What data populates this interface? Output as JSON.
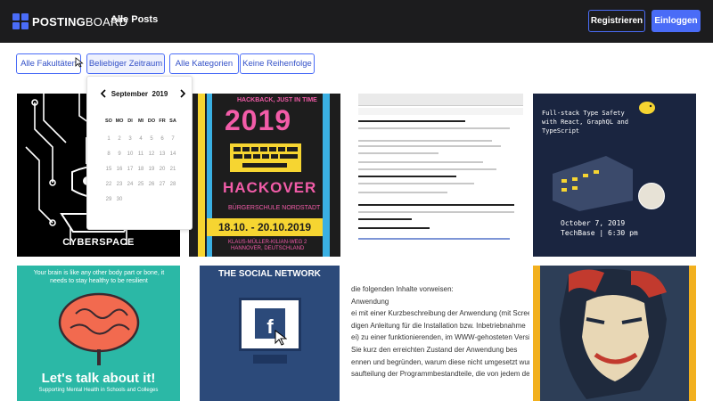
{
  "header": {
    "logo_bold": "POSTING",
    "logo_rest": "BOARD",
    "nav_all_posts": "Alle Posts",
    "register_label": "Registrieren",
    "login_label": "Einloggen",
    "accent_color": "#4a6cf7"
  },
  "filters": {
    "faculties": "Alle Fakultäten",
    "period": "Beliebiger Zeitraum",
    "categories": "Alle Kategorien",
    "order": "Keine Reihenfolge"
  },
  "calendar": {
    "month": "September",
    "year": "2019",
    "weekdays": [
      "SO",
      "MO",
      "DI",
      "MI",
      "DO",
      "FR",
      "SA"
    ],
    "days": [
      "1",
      "2",
      "3",
      "4",
      "5",
      "6",
      "7",
      "8",
      "9",
      "10",
      "11",
      "12",
      "13",
      "14",
      "15",
      "16",
      "17",
      "18",
      "19",
      "20",
      "21",
      "22",
      "23",
      "24",
      "25",
      "26",
      "27",
      "28",
      "29",
      "30"
    ],
    "prev_icon": "chevron-left-icon",
    "next_icon": "chevron-right-icon"
  },
  "posts": {
    "cyberspace": {
      "label": "CYBERSPACE"
    },
    "hackover": {
      "top": "HACKBACK, JUST IN TIME",
      "year": "2019",
      "name": "HACKOVER",
      "school": "BÜRGERSCHULE NORDSTADT",
      "dates": "18.10. - 20.10.2019",
      "address1": "KLAUS-MÜLLER-KILIAN-WEG 2",
      "address2": "HANNOVER, DEUTSCHLAND"
    },
    "techbase": {
      "title_line1": "Full-stack Type Safety",
      "title_line2": "with React, GraphQL and",
      "title_line3": "TypeScript",
      "date": "October 7, 2019",
      "place": "TechBase | 6:30 pm"
    },
    "mental_health": {
      "top": "Your brain is like any other body part or bone, it needs to stay healthy to be resilient",
      "big": "Let's talk about it!",
      "sub": "Supporting Mental Health in Schools and Colleges"
    },
    "social_network": {
      "title": "THE SOCIAL NETWORK"
    },
    "article": {
      "lines": [
        "die folgenden Inhalte vorweisen:",
        "Anwendung",
        "ei mit einer Kurzbeschreibung der Anwendung (mit Scree",
        "digen Anleitung für die Installation bzw. Inbetriebnahme",
        "ei) zu einer funktionierenden, im WWW-gehosteten Versi",
        "Sie kurz den erreichten Zustand der Anwendung bes",
        "ennen und begründen, warum diese nicht umgesetzt wur",
        "saufteilung der Programmbestandteile, die von jedem de"
      ]
    }
  }
}
